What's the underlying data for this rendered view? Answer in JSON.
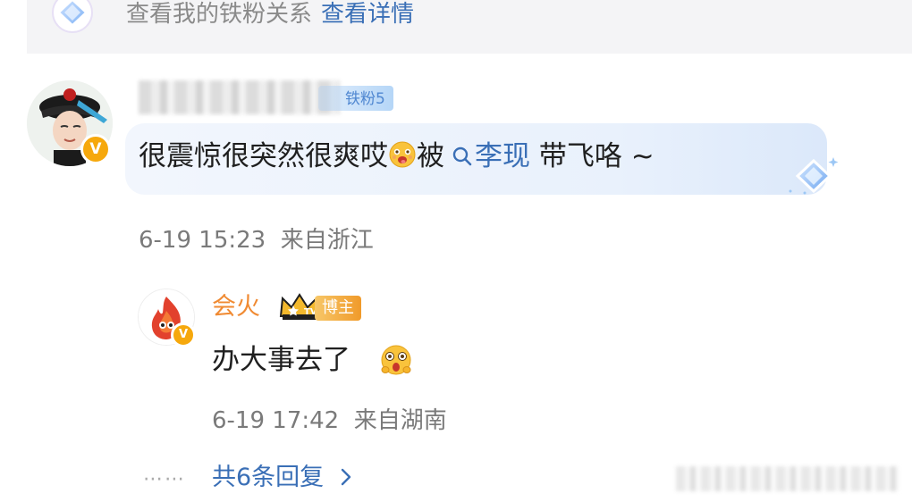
{
  "banner": {
    "text": "查看我的铁粉关系",
    "link": "查看详情",
    "icon": "diamond-fan-icon"
  },
  "comment": {
    "fan_badge": "铁粉5",
    "text_before_emoji": "很震惊很突然很爽哎",
    "emoji": "drooling-face-emoji",
    "text_after_emoji": "被",
    "mention": "李现",
    "text_tail": " 带飞咯 ~",
    "time": "6-19 15:23",
    "location": "来自浙江"
  },
  "reply": {
    "author": "会火",
    "badge": "博主",
    "text": "办大事去了",
    "emoji": "excited-face-emoji",
    "time": "6-19 17:42",
    "location": "来自湖南"
  },
  "more_replies": {
    "dots": "⋯⋯",
    "label": "共6条回复",
    "icon": "chevron-right-icon"
  },
  "colors": {
    "link": "#3a6fb6",
    "author_orange": "#f08a32",
    "verified": "#f6a80c",
    "meta_gray": "#7a7a7a"
  }
}
